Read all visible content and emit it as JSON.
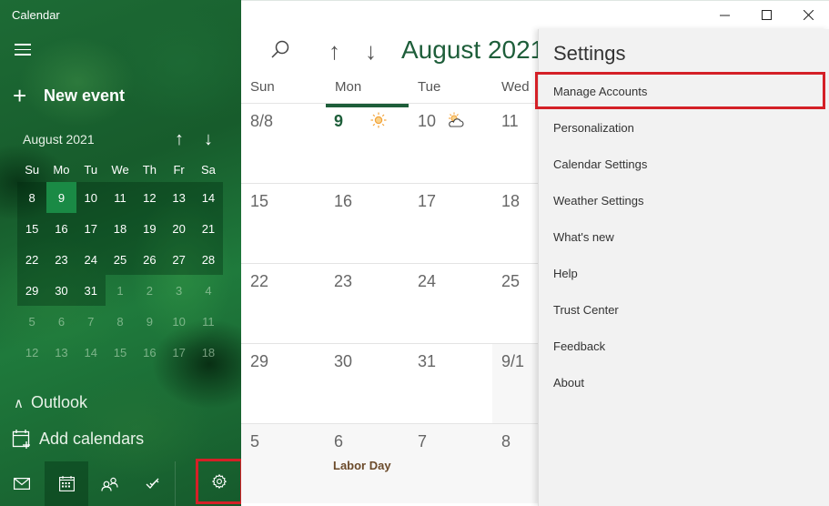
{
  "app": {
    "title": "Calendar"
  },
  "sidebar": {
    "new_event_label": "New event",
    "mini_calendar": {
      "month_label": "August 2021",
      "weekdays": [
        "Su",
        "Mo",
        "Tu",
        "We",
        "Th",
        "Fr",
        "Sa"
      ],
      "days": [
        {
          "d": "8",
          "t": "in"
        },
        {
          "d": "9",
          "t": "today"
        },
        {
          "d": "10",
          "t": "in"
        },
        {
          "d": "11",
          "t": "in"
        },
        {
          "d": "12",
          "t": "in"
        },
        {
          "d": "13",
          "t": "in"
        },
        {
          "d": "14",
          "t": "in"
        },
        {
          "d": "15",
          "t": "in"
        },
        {
          "d": "16",
          "t": "in"
        },
        {
          "d": "17",
          "t": "in"
        },
        {
          "d": "18",
          "t": "in"
        },
        {
          "d": "19",
          "t": "in"
        },
        {
          "d": "20",
          "t": "in"
        },
        {
          "d": "21",
          "t": "in"
        },
        {
          "d": "22",
          "t": "in"
        },
        {
          "d": "23",
          "t": "in"
        },
        {
          "d": "24",
          "t": "in"
        },
        {
          "d": "25",
          "t": "in"
        },
        {
          "d": "26",
          "t": "in"
        },
        {
          "d": "27",
          "t": "in"
        },
        {
          "d": "28",
          "t": "in"
        },
        {
          "d": "29",
          "t": "in"
        },
        {
          "d": "30",
          "t": "in"
        },
        {
          "d": "31",
          "t": "in"
        },
        {
          "d": "1",
          "t": "out"
        },
        {
          "d": "2",
          "t": "out"
        },
        {
          "d": "3",
          "t": "out"
        },
        {
          "d": "4",
          "t": "out"
        },
        {
          "d": "5",
          "t": "out"
        },
        {
          "d": "6",
          "t": "out"
        },
        {
          "d": "7",
          "t": "out"
        },
        {
          "d": "8",
          "t": "out"
        },
        {
          "d": "9",
          "t": "out"
        },
        {
          "d": "10",
          "t": "out"
        },
        {
          "d": "11",
          "t": "out"
        },
        {
          "d": "12",
          "t": "out"
        },
        {
          "d": "13",
          "t": "out"
        },
        {
          "d": "14",
          "t": "out"
        },
        {
          "d": "15",
          "t": "out"
        },
        {
          "d": "16",
          "t": "out"
        },
        {
          "d": "17",
          "t": "out"
        },
        {
          "d": "18",
          "t": "out"
        }
      ]
    },
    "account_group": "Outlook",
    "add_calendars_label": "Add calendars",
    "bottom_nav": [
      "mail",
      "calendar",
      "people",
      "todo",
      "settings"
    ]
  },
  "main": {
    "month_title": "August 2021",
    "day_headers": [
      "Sun",
      "Mon",
      "Tue",
      "Wed"
    ],
    "weeks": [
      [
        {
          "num": "8/8"
        },
        {
          "num": "9",
          "today": true,
          "weather": "sunny"
        },
        {
          "num": "10",
          "weather": "partly-cloudy"
        },
        {
          "num": "11"
        }
      ],
      [
        {
          "num": "15"
        },
        {
          "num": "16"
        },
        {
          "num": "17"
        },
        {
          "num": "18"
        }
      ],
      [
        {
          "num": "22"
        },
        {
          "num": "23"
        },
        {
          "num": "24"
        },
        {
          "num": "25"
        }
      ],
      [
        {
          "num": "29"
        },
        {
          "num": "30"
        },
        {
          "num": "31"
        },
        {
          "num": "9/1",
          "shaded": true
        }
      ],
      [
        {
          "num": "5"
        },
        {
          "num": "6",
          "event": "Labor Day"
        },
        {
          "num": "7"
        },
        {
          "num": "8"
        }
      ]
    ]
  },
  "settings": {
    "title": "Settings",
    "items": [
      "Manage Accounts",
      "Personalization",
      "Calendar Settings",
      "Weather Settings",
      "What's new",
      "Help",
      "Trust Center",
      "Feedback",
      "About"
    ],
    "highlighted_item": "Manage Accounts"
  },
  "colors": {
    "accent": "#1e5e3a",
    "highlight": "#d42027",
    "today_mini": "#1a8a45"
  }
}
